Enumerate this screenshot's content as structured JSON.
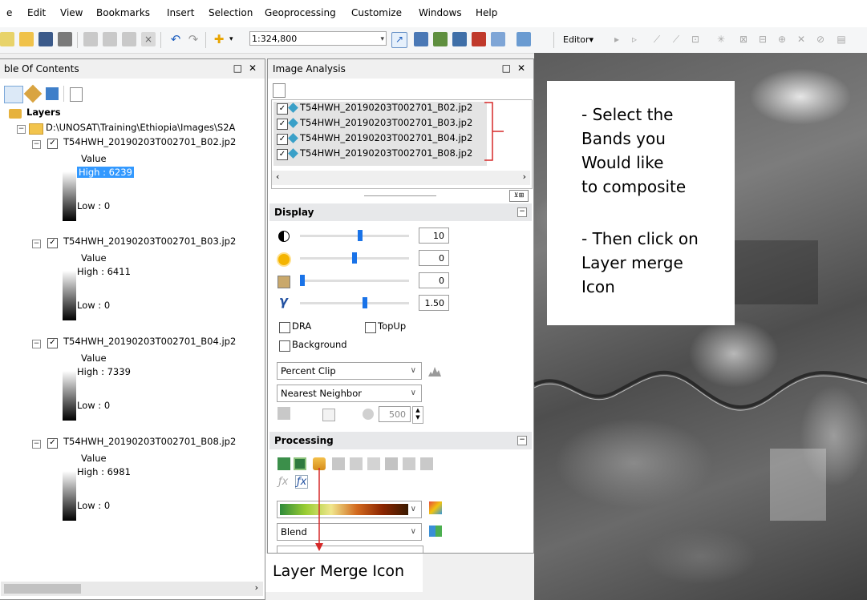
{
  "menu": [
    "e",
    "Edit",
    "View",
    "Bookmarks",
    "Insert",
    "Selection",
    "Geoprocessing",
    "Customize",
    "Windows",
    "Help"
  ],
  "toolbar": {
    "scale": "1:324,800",
    "editor": "Editor▾"
  },
  "toc": {
    "title": "ble Of Contents",
    "root": "Layers",
    "folder": "D:\\UNOSAT\\Training\\Ethiopia\\Images\\S2A",
    "layers": [
      {
        "name": "T54HWH_20190203T002701_B02.jp2",
        "value_label": "Value",
        "high": "High : 6239",
        "low": "Low : 0"
      },
      {
        "name": "T54HWH_20190203T002701_B03.jp2",
        "value_label": "Value",
        "high": "High : 6411",
        "low": "Low : 0"
      },
      {
        "name": "T54HWH_20190203T002701_B04.jp2",
        "value_label": "Value",
        "high": "High : 7339",
        "low": "Low : 0"
      },
      {
        "name": "T54HWH_20190203T002701_B08.jp2",
        "value_label": "Value",
        "high": "High : 6981",
        "low": "Low : 0"
      }
    ]
  },
  "image_analysis": {
    "title": "Image Analysis",
    "layers": [
      "T54HWH_20190203T002701_B02.jp2",
      "T54HWH_20190203T002701_B03.jp2",
      "T54HWH_20190203T002701_B04.jp2",
      "T54HWH_20190203T002701_B08.jp2"
    ],
    "display": {
      "title": "Display",
      "contrast": "10",
      "brightness": "0",
      "transparency": "0",
      "gamma": "1.50",
      "contrast_level": 0.55,
      "brightness_level": 0.5,
      "transparency_level": 0.0,
      "gamma_level": 0.6,
      "dra_label": "DRA",
      "topup_label": "TopUp",
      "background_label": "Background",
      "stretch": "Percent Clip",
      "resampling": "Nearest Neighbor",
      "dpi": "500"
    },
    "processing": {
      "title": "Processing",
      "blend": "Blend"
    }
  },
  "annotations": {
    "note_lines": [
      "- Select the",
      "Bands you",
      "Would like",
      "to composite",
      "",
      "- Then click on",
      "Layer merge",
      "Icon"
    ],
    "merge_callout": "Layer Merge Icon",
    "accent_color": "#d62828"
  }
}
